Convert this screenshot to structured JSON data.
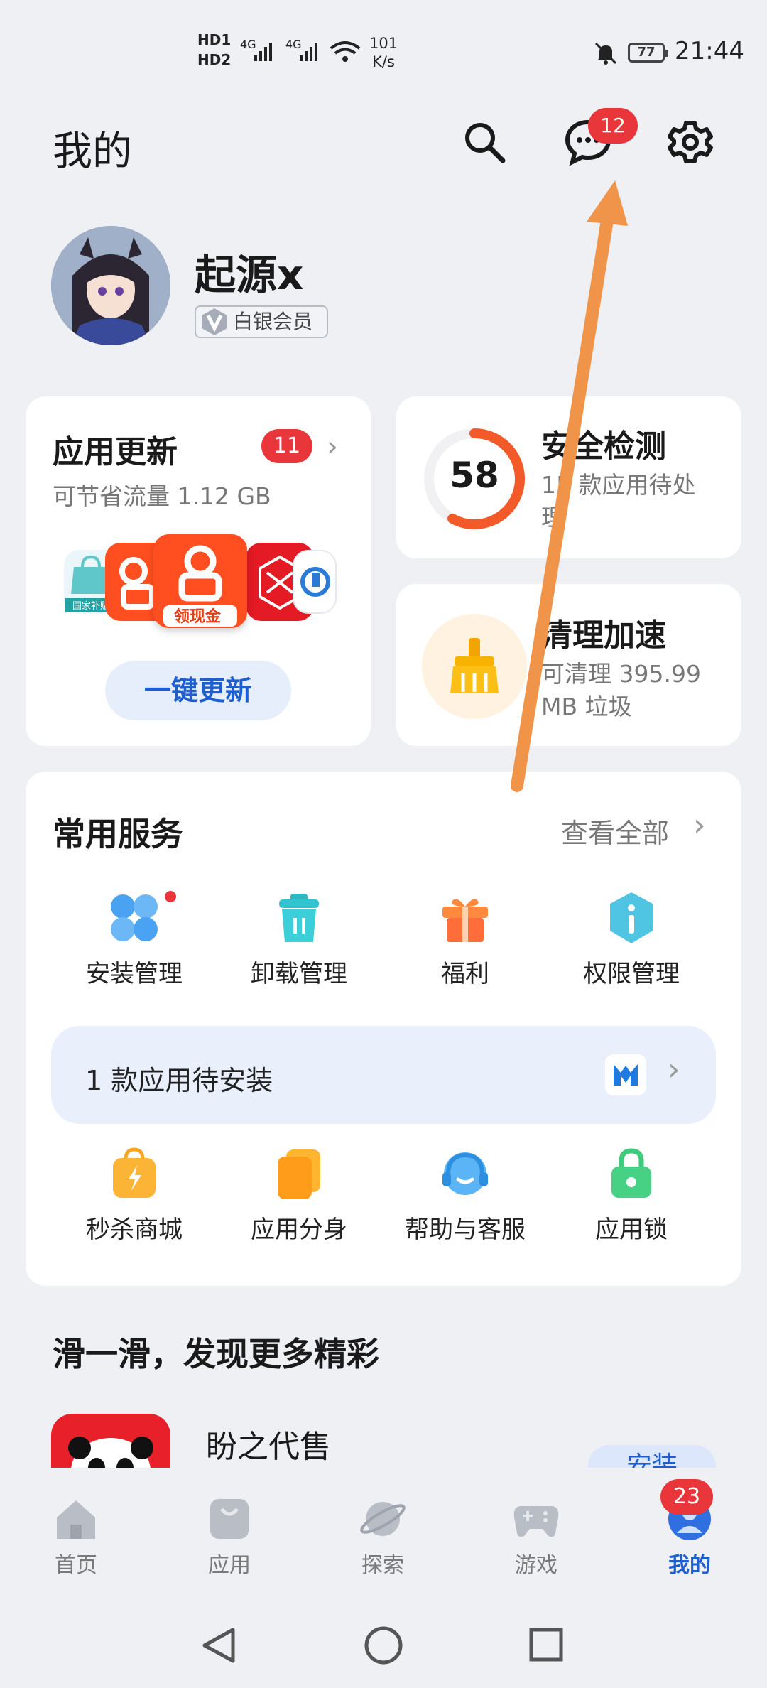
{
  "status_bar": {
    "hd1": "HD1",
    "hd2": "HD2",
    "net1": "4G",
    "net2": "4G",
    "speed_value": "101",
    "speed_unit": "K/s",
    "battery": "77",
    "time": "21:44"
  },
  "header": {
    "title": "我的",
    "message_count": "12"
  },
  "profile": {
    "username": "起源x",
    "member_level": "白银会员"
  },
  "app_update": {
    "title": "应用更新",
    "count": "11",
    "subtitle": "可节省流量 1.12 GB",
    "app_icons": [
      "honor-icon",
      "kuaishou-icon",
      "kuaishou-icon",
      "pinduoduo-icon",
      "ccb-icon"
    ],
    "featured_label": "领现金",
    "honor_label": "国家补贴",
    "button": "一键更新"
  },
  "security": {
    "score": "58",
    "title": "安全检测",
    "subtitle": "15 款应用待处理"
  },
  "cleanup": {
    "title": "清理加速",
    "subtitle": "可清理 395.99 MB 垃圾"
  },
  "services": {
    "title": "常用服务",
    "view_all": "查看全部",
    "row1": [
      {
        "label": "安装管理",
        "icon": "install-manage-icon"
      },
      {
        "label": "卸载管理",
        "icon": "uninstall-trash-icon"
      },
      {
        "label": "福利",
        "icon": "gift-icon"
      },
      {
        "label": "权限管理",
        "icon": "permission-shield-icon"
      }
    ],
    "pending_text": "1 款应用待安装",
    "row2": [
      {
        "label": "秒杀商城",
        "icon": "flash-bag-icon"
      },
      {
        "label": "应用分身",
        "icon": "app-clone-icon"
      },
      {
        "label": "帮助与客服",
        "icon": "support-headset-icon"
      },
      {
        "label": "应用锁",
        "icon": "lock-icon"
      }
    ]
  },
  "discover": {
    "title": "滑一滑，发现更多精彩",
    "app_name": "盼之代售",
    "install_label": "安装"
  },
  "bottom_nav": {
    "items": [
      "首页",
      "应用",
      "探索",
      "游戏",
      "我的"
    ],
    "badge": "23"
  },
  "colors": {
    "accent": "#1e5fd0",
    "badge_red": "#e8363a",
    "annotation_arrow": "#f0944a"
  }
}
